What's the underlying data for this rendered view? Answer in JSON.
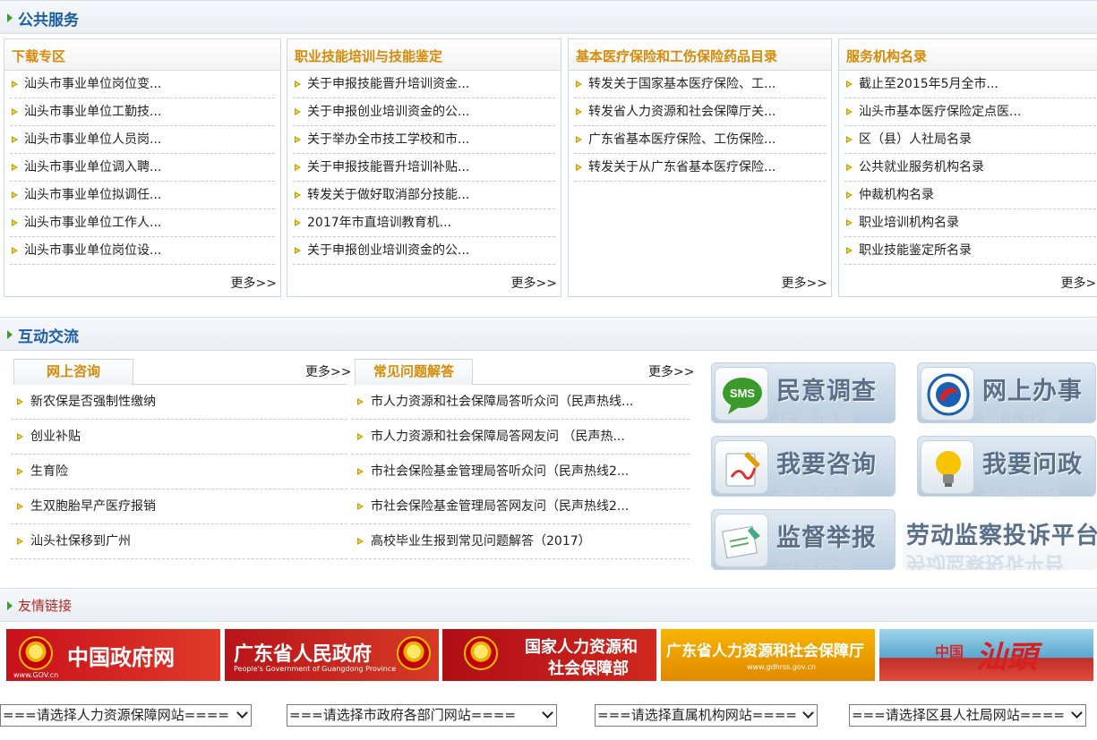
{
  "public_service": {
    "title": "公共服务",
    "more_label": "更多>>",
    "boxes": [
      {
        "title": "下载专区",
        "items": [
          "汕头市事业单位岗位变...",
          "汕头市事业单位工勤技...",
          "汕头市事业单位人员岗...",
          "汕头市事业单位调入聘...",
          "汕头市事业单位拟调任...",
          "汕头市事业单位工作人...",
          "汕头市事业单位岗位设..."
        ]
      },
      {
        "title": "职业技能培训与技能鉴定",
        "items": [
          "关于申报技能晋升培训资金...",
          "关于申报创业培训资金的公...",
          "关于举办全市技工学校和市...",
          "关于申报技能晋升培训补贴...",
          "转发关于做好取消部分技能...",
          "2017年市直培训教育机...",
          "关于申报创业培训资金的公..."
        ]
      },
      {
        "title": "基本医疗保险和工伤保险药品目录",
        "items": [
          "转发关于国家基本医疗保险、工...",
          "转发省人力资源和社会保障厅关...",
          "广东省基本医疗保险、工伤保险...",
          "转发关于从广东省基本医疗保险..."
        ]
      },
      {
        "title": "服务机构名录",
        "items": [
          "截止至2015年5月全市...",
          "汕头市基本医疗保险定点医...",
          "区（县）人社局名录",
          "公共就业服务机构名录",
          "仲裁机构名录",
          "职业培训机构名录",
          "职业技能鉴定所名录"
        ]
      }
    ]
  },
  "interaction": {
    "title": "互动交流",
    "tabs": [
      {
        "label": "网上咨询",
        "more_label": "更多>>",
        "items": [
          "新农保是否强制性缴纳",
          "创业补贴",
          "生育险",
          "生双胞胎早产医疗报销",
          "汕头社保移到广州"
        ]
      },
      {
        "label": "常见问题解答",
        "more_label": "更多>>",
        "items": [
          "市人力资源和社会保障局答听众问（民声热线...",
          "市人力资源和社会保障局答网友问 （民声热...",
          "市社会保险基金管理局答听众问（民声热线2...",
          "市社会保险基金管理局答网友问（民声热线2...",
          "高校毕业生报到常见问题解答（2017）"
        ]
      }
    ],
    "buttons": [
      "民意调查",
      "网上办事",
      "我要咨询",
      "我要问政",
      "监督举报",
      "劳动监察投诉平台"
    ],
    "sms_text": "SMS"
  },
  "links": {
    "title": "友情链接",
    "banners": [
      {
        "name": "中国政府网",
        "sub": "www.GOV.cn"
      },
      {
        "name": "广东省人民政府",
        "sub": "People's Government of Guangdong Province"
      },
      {
        "name": "国家人力资源和",
        "name2": "社会保障部"
      },
      {
        "name": "广东省人力资源和社会保障厅",
        "sub": "www.gdhrss.gov.cn"
      },
      {
        "name": "中国",
        "name2": "汕頭"
      }
    ],
    "selects": [
      "===请选择人力资源保障网站====",
      "===请选择市政府各部门网站====",
      "===请选择直属机构网站====",
      "===请选择区县人社局网站===="
    ]
  },
  "colors": {
    "section_title": "#1c5ea8",
    "box_title": "#d78a06",
    "link_title": "#b8271f",
    "arrow": "#c89a00"
  }
}
